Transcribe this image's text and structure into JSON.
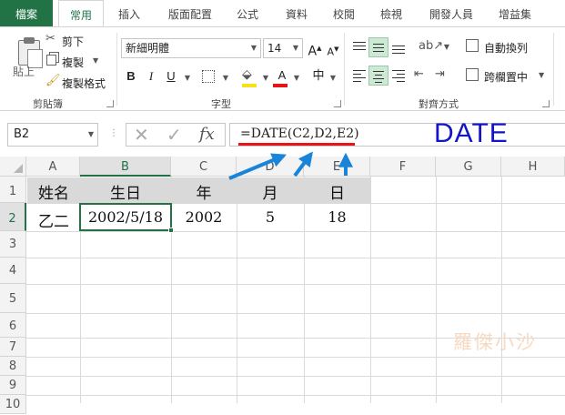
{
  "tabs": [
    "檔案",
    "常用",
    "插入",
    "版面配置",
    "公式",
    "資料",
    "校閱",
    "檢視",
    "開發人員",
    "增益集"
  ],
  "ribbon": {
    "clipboard": {
      "paste": "貼上",
      "cut": "剪下",
      "copy": "複製",
      "format_painter": "複製格式",
      "group": "剪貼簿"
    },
    "font": {
      "font_name": "新細明體",
      "font_size": "14",
      "grow": "A",
      "shrink": "A",
      "bold": "B",
      "italic": "I",
      "underline": "U",
      "font_color_glyph": "A",
      "phonetic": "中",
      "group": "字型"
    },
    "alignment": {
      "wrap_text": "自動換列",
      "merge_center": "跨欄置中",
      "group": "對齊方式"
    }
  },
  "formula_bar": {
    "name_box": "B2",
    "fx": "fx",
    "formula": "=DATE(C2,D2,E2)",
    "annotation": "DATE"
  },
  "grid": {
    "columns": [
      "A",
      "B",
      "C",
      "D",
      "E",
      "F",
      "G",
      "H"
    ],
    "rows": [
      "1",
      "2",
      "3",
      "4",
      "5",
      "6",
      "7",
      "8",
      "9",
      "10"
    ],
    "row1": [
      "姓名",
      "生日",
      "年",
      "月",
      "日"
    ],
    "row2": [
      "乙二",
      "2002/5/18",
      "2002",
      "5",
      "18"
    ],
    "selected_cell": "B2"
  },
  "watermark": "羅傑小沙",
  "colors": {
    "accent": "#217346",
    "annotation_blue": "#1414c8",
    "arrow_blue": "#1a84d8",
    "underline_red": "#e8121a"
  }
}
